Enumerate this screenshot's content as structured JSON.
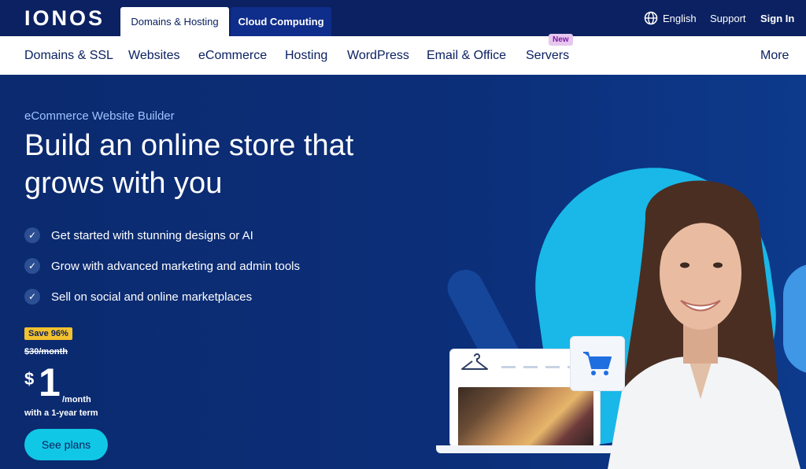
{
  "header": {
    "logo": "IONOS",
    "tabs": [
      {
        "label": "Domains & Hosting",
        "active": true
      },
      {
        "label": "Cloud Computing",
        "active": false
      }
    ],
    "language": "English",
    "support": "Support",
    "sign_in": "Sign In"
  },
  "nav": {
    "items": [
      "Domains & SSL",
      "Websites",
      "eCommerce",
      "Hosting",
      "WordPress",
      "Email & Office",
      "Servers"
    ],
    "new_badge": "New",
    "more": "More"
  },
  "hero": {
    "eyebrow": "eCommerce Website Builder",
    "headline": "Build an online store that grows with you",
    "features": [
      "Get started with stunning designs or AI",
      "Grow with advanced marketing and admin tools",
      "Sell on social and online marketplaces"
    ],
    "save_badge": "Save 96%",
    "old_price": "$30/month",
    "currency": "$",
    "price": "1",
    "per_month": "/month",
    "term": "with a 1-year term",
    "cta": "See plans"
  },
  "colors": {
    "navy": "#0b2161",
    "accent": "#11c7e6",
    "save": "#f2c12e"
  },
  "icons": {
    "globe": "globe-icon",
    "check": "check-icon",
    "cart": "shopping-cart-icon",
    "hanger": "hanger-icon"
  }
}
